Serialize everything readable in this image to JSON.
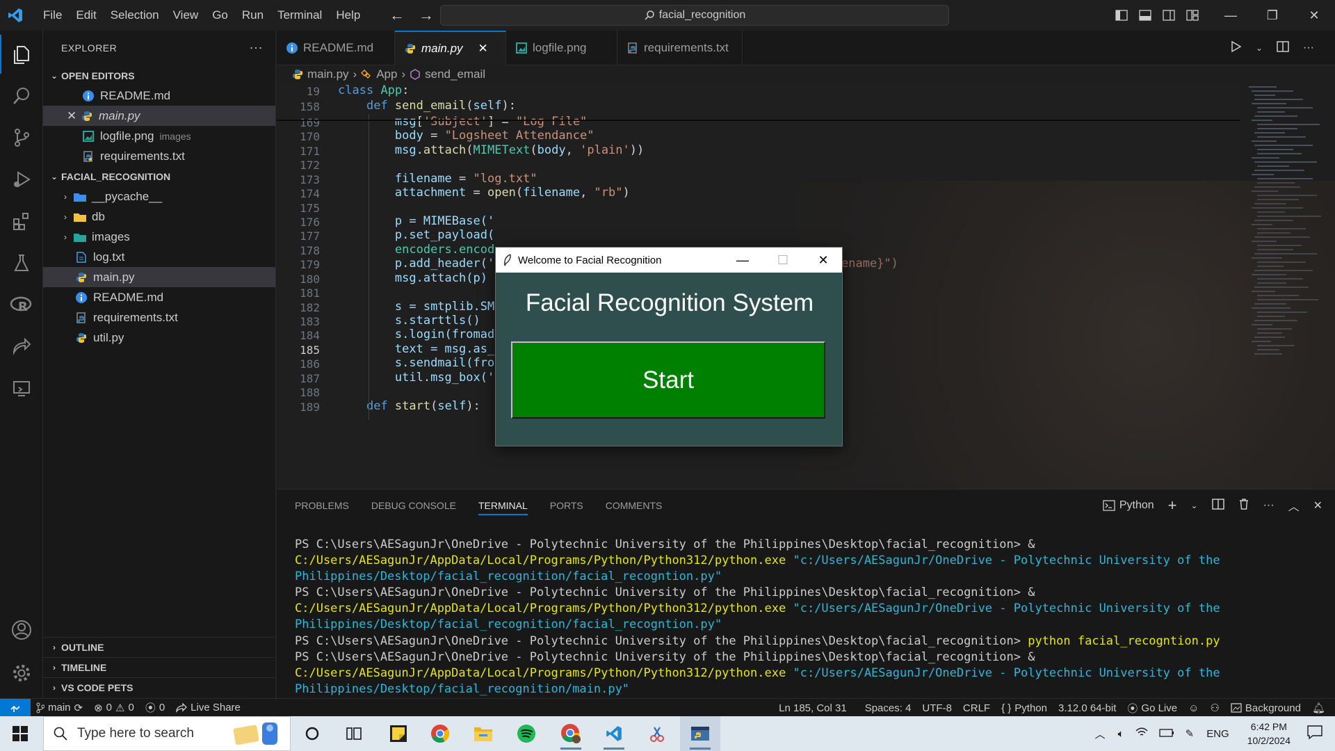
{
  "titlebar": {
    "menu": [
      "File",
      "Edit",
      "Selection",
      "View",
      "Go",
      "Run",
      "Terminal",
      "Help"
    ],
    "search": "facial_recognition"
  },
  "sidebar": {
    "title": "EXPLORER",
    "open_editors": {
      "heading": "OPEN EDITORS",
      "items": [
        {
          "name": "README.md",
          "desc": ""
        },
        {
          "name": "main.py",
          "desc": ""
        },
        {
          "name": "logfile.png",
          "desc": "images"
        },
        {
          "name": "requirements.txt",
          "desc": ""
        }
      ]
    },
    "project": {
      "heading": "FACIAL_RECOGNITION",
      "items": [
        "__pycache__",
        "db",
        "images",
        "log.txt",
        "main.py",
        "README.md",
        "requirements.txt",
        "util.py"
      ]
    },
    "bottom_sections": [
      "OUTLINE",
      "TIMELINE",
      "VS CODE PETS"
    ]
  },
  "tabs": [
    "README.md",
    "main.py",
    "logfile.png",
    "requirements.txt"
  ],
  "breadcrumb": [
    "main.py",
    "App",
    "send_email"
  ],
  "editor": {
    "line_numbers": [
      "19",
      "158",
      "169",
      "170",
      "171",
      "172",
      "173",
      "174",
      "175",
      "176",
      "177",
      "178",
      "179",
      "180",
      "181",
      "182",
      "183",
      "184",
      "185",
      "186",
      "187",
      "188",
      "189"
    ],
    "current_line": "185",
    "fragments": {
      "p176": "p = MIMEBase('",
      "p177": "p.set_payload(",
      "p178": "encoders.encod",
      "p179": "p.add_header('",
      "p179_tail": "ename}\")",
      "p180": "msg.attach(p)",
      "p182": "s = smtplib.SM",
      "p183": "s.starttls()",
      "p184": "s.login(fromad",
      "p185": "text = msg.as_",
      "p186": "s.sendmail(fro",
      "p187": "util.msg_box('"
    }
  },
  "dialog": {
    "title": "Welcome to Facial Recognition",
    "heading": "Facial Recognition System",
    "button": "Start"
  },
  "panel": {
    "tabs": [
      "PROBLEMS",
      "DEBUG CONSOLE",
      "TERMINAL",
      "PORTS",
      "COMMENTS"
    ],
    "active_tab": "TERMINAL",
    "shell": "Python",
    "prompt": "PS C:\\Users\\AESagunJr\\OneDrive - Polytechnic University of the Philippines\\Desktop\\facial_recognition>",
    "lines": [
      {
        "cmd": "& ",
        "exe": "C:/Users/AESagunJr/AppData/Local/Programs/Python/Python312/python.exe",
        "arg": "\"c:/Users/AESagunJr/OneDrive - Polytechnic University of the Philippines/Desktop/facial_recognition/facial_recogntion.py\""
      },
      {
        "cmd": "& ",
        "exe": "C:/Users/AESagunJr/AppData/Local/Programs/Python/Python312/python.exe",
        "arg": "\"c:/Users/AESagunJr/OneDrive - Polytechnic University of the Philippines/Desktop/facial_recognition/facial_recogntion.py\""
      },
      {
        "cmd": "python facial_recogntion.py",
        "exe": "",
        "arg": ""
      },
      {
        "cmd": "& ",
        "exe": "C:/Users/AESagunJr/AppData/Local/Programs/Python/Python312/python.exe",
        "arg": "\"c:/Users/AESagunJr/OneDrive - Polytechnic University of the Philippines/Desktop/facial_recognition/main.py\""
      }
    ]
  },
  "statusbar": {
    "branch": "main",
    "errors": "0",
    "warnings": "0",
    "ports": "0",
    "live_share": "Live Share",
    "position": "Ln 185, Col 31",
    "spaces": "Spaces: 4",
    "encoding": "UTF-8",
    "eol": "CRLF",
    "language": "Python",
    "interpreter": "3.12.0 64-bit",
    "go_live": "Go Live",
    "background": "Background"
  },
  "taskbar": {
    "search_placeholder": "Type here to search",
    "lang": "ENG",
    "time": "6:42 PM",
    "date": "10/2/2024"
  },
  "colors": {
    "accent": "#0078d4",
    "dialog_bg": "#2f4f4f",
    "start_button": "#008000"
  }
}
